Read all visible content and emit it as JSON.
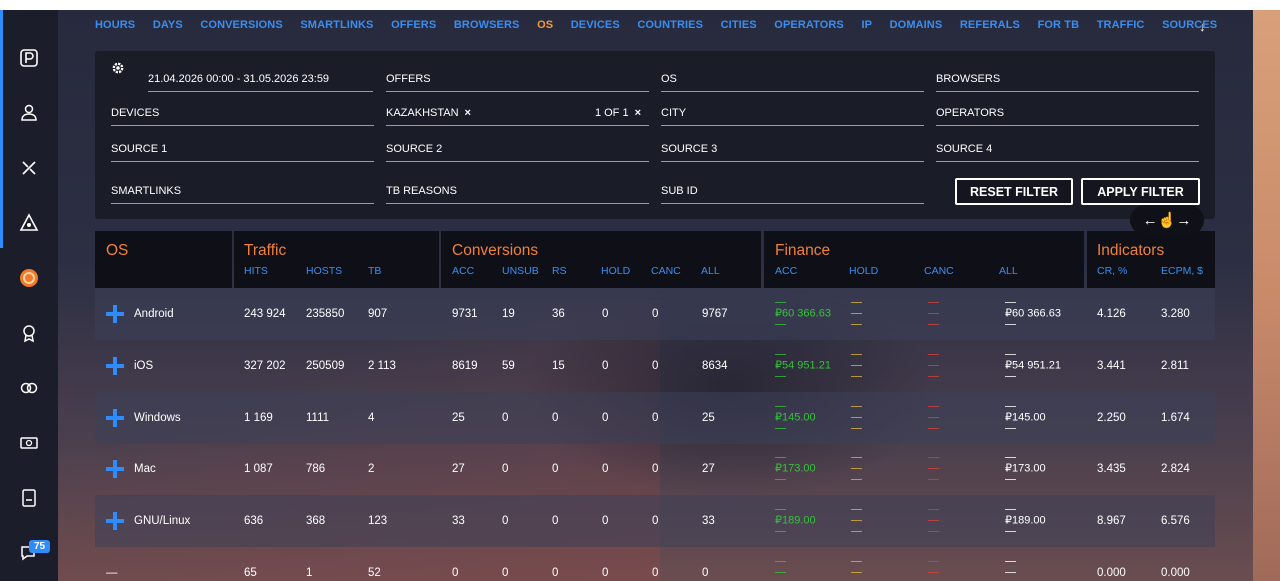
{
  "nav": {
    "tabs": [
      "HOURS",
      "DAYS",
      "CONVERSIONS",
      "SMARTLINKS",
      "OFFERS",
      "BROWSERS",
      "OS",
      "DEVICES",
      "COUNTRIES",
      "CITIES",
      "OPERATORS",
      "IP",
      "DOMAINS",
      "REFERALS",
      "FOR TB",
      "TRAFFIC",
      "SOURCES"
    ],
    "active": "OS",
    "more_icon": "arrow-down-icon",
    "more_symbol": "↓"
  },
  "sidebar": {
    "items": [
      "parking-icon",
      "users-icon",
      "tools-icon",
      "triangle-icon",
      "circle-target-icon",
      "award-icon",
      "links-icon",
      "money-icon",
      "document-icon",
      "chat-icon"
    ],
    "chat_badge": "75"
  },
  "filters": {
    "date_range": "21.04.2026 00:00 - 31.05.2026 23:59",
    "offers": "OFFERS",
    "os": "OS",
    "browsers": "BROWSERS",
    "devices": "DEVICES",
    "country_chip": "KAZAKHSTAN",
    "country_count": "1 OF 1",
    "city": "CITY",
    "operators": "OPERATORS",
    "source1": "SOURCE 1",
    "source2": "SOURCE 2",
    "source3": "SOURCE 3",
    "source4": "SOURCE 4",
    "smartlinks": "SMARTLINKS",
    "tb_reasons": "TB REASONS",
    "sub_id": "SUB ID",
    "reset_label": "RESET FILTER",
    "apply_label": "APPLY FILTER",
    "close_symbol": "×"
  },
  "scroll_hint": "←☝→",
  "table": {
    "groups": {
      "os": "OS",
      "traffic": "Traffic",
      "conversions": "Conversions",
      "finance": "Finance",
      "indicators": "Indicators"
    },
    "traffic_cols": [
      "HITS",
      "HOSTS",
      "TB"
    ],
    "conv_cols": [
      "ACC",
      "UNSUB",
      "RS",
      "HOLD",
      "CANC",
      "ALL"
    ],
    "fin_cols": [
      "ACC",
      "HOLD",
      "CANC",
      "ALL"
    ],
    "ind_cols": [
      "CR, %",
      "ECPM, $"
    ],
    "dash": "—",
    "rows": [
      {
        "os": "Android",
        "hits": "243 924",
        "hosts": "235850",
        "tb": "907",
        "acc": "9731",
        "unsub": "19",
        "rs": "36",
        "hold": "0",
        "canc": "0",
        "all": "9767",
        "fin_acc": "₽60 366.63",
        "fin_all": "₽60 366.63",
        "cr": "4.126",
        "ecpm": "3.280",
        "expand": true
      },
      {
        "os": "iOS",
        "hits": "327 202",
        "hosts": "250509",
        "tb": "2 113",
        "acc": "8619",
        "unsub": "59",
        "rs": "15",
        "hold": "0",
        "canc": "0",
        "all": "8634",
        "fin_acc": "₽54 951.21",
        "fin_all": "₽54 951.21",
        "cr": "3.441",
        "ecpm": "2.811",
        "expand": true
      },
      {
        "os": "Windows",
        "hits": "1 169",
        "hosts": "1111",
        "tb": "4",
        "acc": "25",
        "unsub": "0",
        "rs": "0",
        "hold": "0",
        "canc": "0",
        "all": "25",
        "fin_acc": "₽145.00",
        "fin_all": "₽145.00",
        "cr": "2.250",
        "ecpm": "1.674",
        "expand": true
      },
      {
        "os": "Mac",
        "hits": "1 087",
        "hosts": "786",
        "tb": "2",
        "acc": "27",
        "unsub": "0",
        "rs": "0",
        "hold": "0",
        "canc": "0",
        "all": "27",
        "fin_acc": "₽173.00",
        "fin_all": "₽173.00",
        "cr": "3.435",
        "ecpm": "2.824",
        "expand": true
      },
      {
        "os": "GNU/Linux",
        "hits": "636",
        "hosts": "368",
        "tb": "123",
        "acc": "33",
        "unsub": "0",
        "rs": "0",
        "hold": "0",
        "canc": "0",
        "all": "33",
        "fin_acc": "₽189.00",
        "fin_all": "₽189.00",
        "cr": "8.967",
        "ecpm": "6.576",
        "expand": true
      },
      {
        "os": "—",
        "hits": "65",
        "hosts": "1",
        "tb": "52",
        "acc": "0",
        "unsub": "0",
        "rs": "0",
        "hold": "0",
        "canc": "0",
        "all": "0",
        "fin_acc": "—",
        "fin_all": "—",
        "cr": "0.000",
        "ecpm": "0.000",
        "expand": false
      }
    ]
  }
}
